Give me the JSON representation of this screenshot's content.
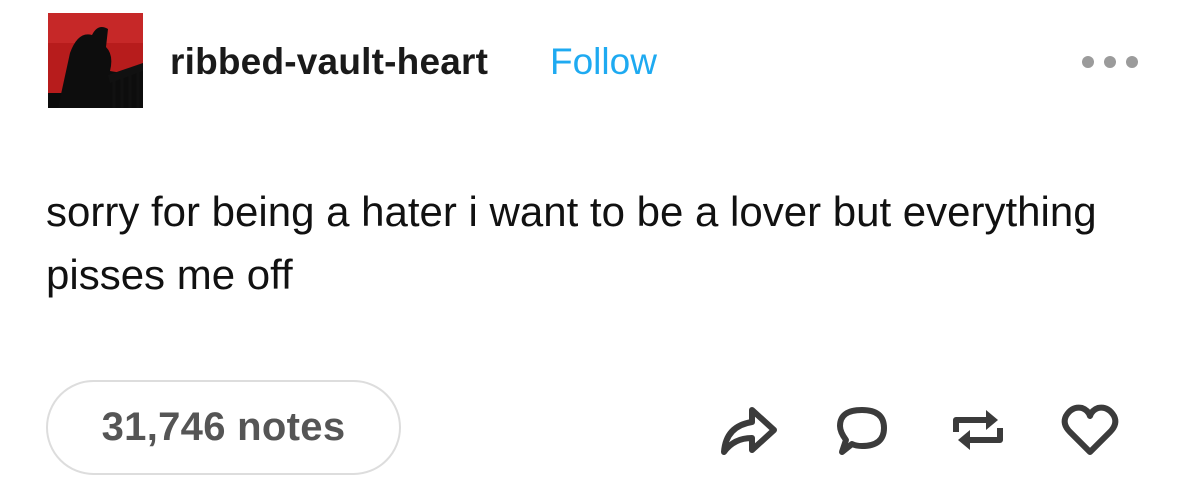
{
  "post": {
    "author": "ribbed-vault-heart",
    "follow_label": "Follow",
    "body": "sorry for being a hater i want to be a lover but everything pisses me off",
    "notes_label": "31,746 notes"
  },
  "icons": {
    "more": "more-options-icon",
    "share": "share-icon",
    "reply": "reply-icon",
    "reblog": "reblog-icon",
    "like": "heart-icon"
  },
  "colors": {
    "follow": "#1eaaf1",
    "avatar_bg": "#b71c1c",
    "icon": "#3b3b3b",
    "pill_border": "#dddddd"
  }
}
